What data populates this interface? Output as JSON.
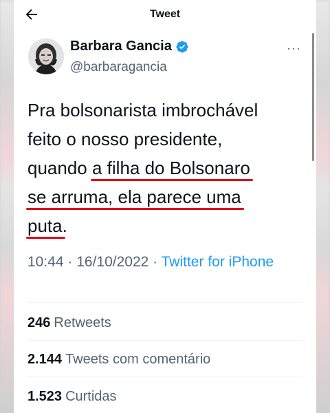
{
  "header": {
    "title": "Tweet",
    "back_icon": "back-arrow-icon"
  },
  "author": {
    "display_name": "Barbara Gancia",
    "handle": "@barbaragancia",
    "verified_icon": "verified-badge-icon",
    "more_icon": "more-options-icon",
    "more_text": "···"
  },
  "tweet": {
    "lines": [
      {
        "before": "Pra bolsonarista imbrochável",
        "highlight": "",
        "after": ""
      },
      {
        "before": "feito o nosso presidente,",
        "highlight": "",
        "after": ""
      },
      {
        "before": "quando ",
        "highlight": "a filha do Bolsonaro",
        "after": ""
      },
      {
        "before": "",
        "highlight": "se arruma, ela parece uma",
        "after": ""
      },
      {
        "before": "",
        "highlight": "puta",
        "after": "."
      }
    ],
    "highlight_color": "#e0081a"
  },
  "meta": {
    "time": "10:44",
    "separator": " · ",
    "date": "16/10/2022",
    "source": "Twitter for iPhone"
  },
  "stats": [
    {
      "value": "246",
      "label": "Retweets"
    },
    {
      "value": "2.144",
      "label": "Tweets com comentário"
    },
    {
      "value": "1.523",
      "label": "Curtidas"
    }
  ],
  "colors": {
    "text": "#0f1419",
    "secondary": "#536471",
    "link": "#1d9bf0",
    "verified": "#1d9bf0"
  }
}
